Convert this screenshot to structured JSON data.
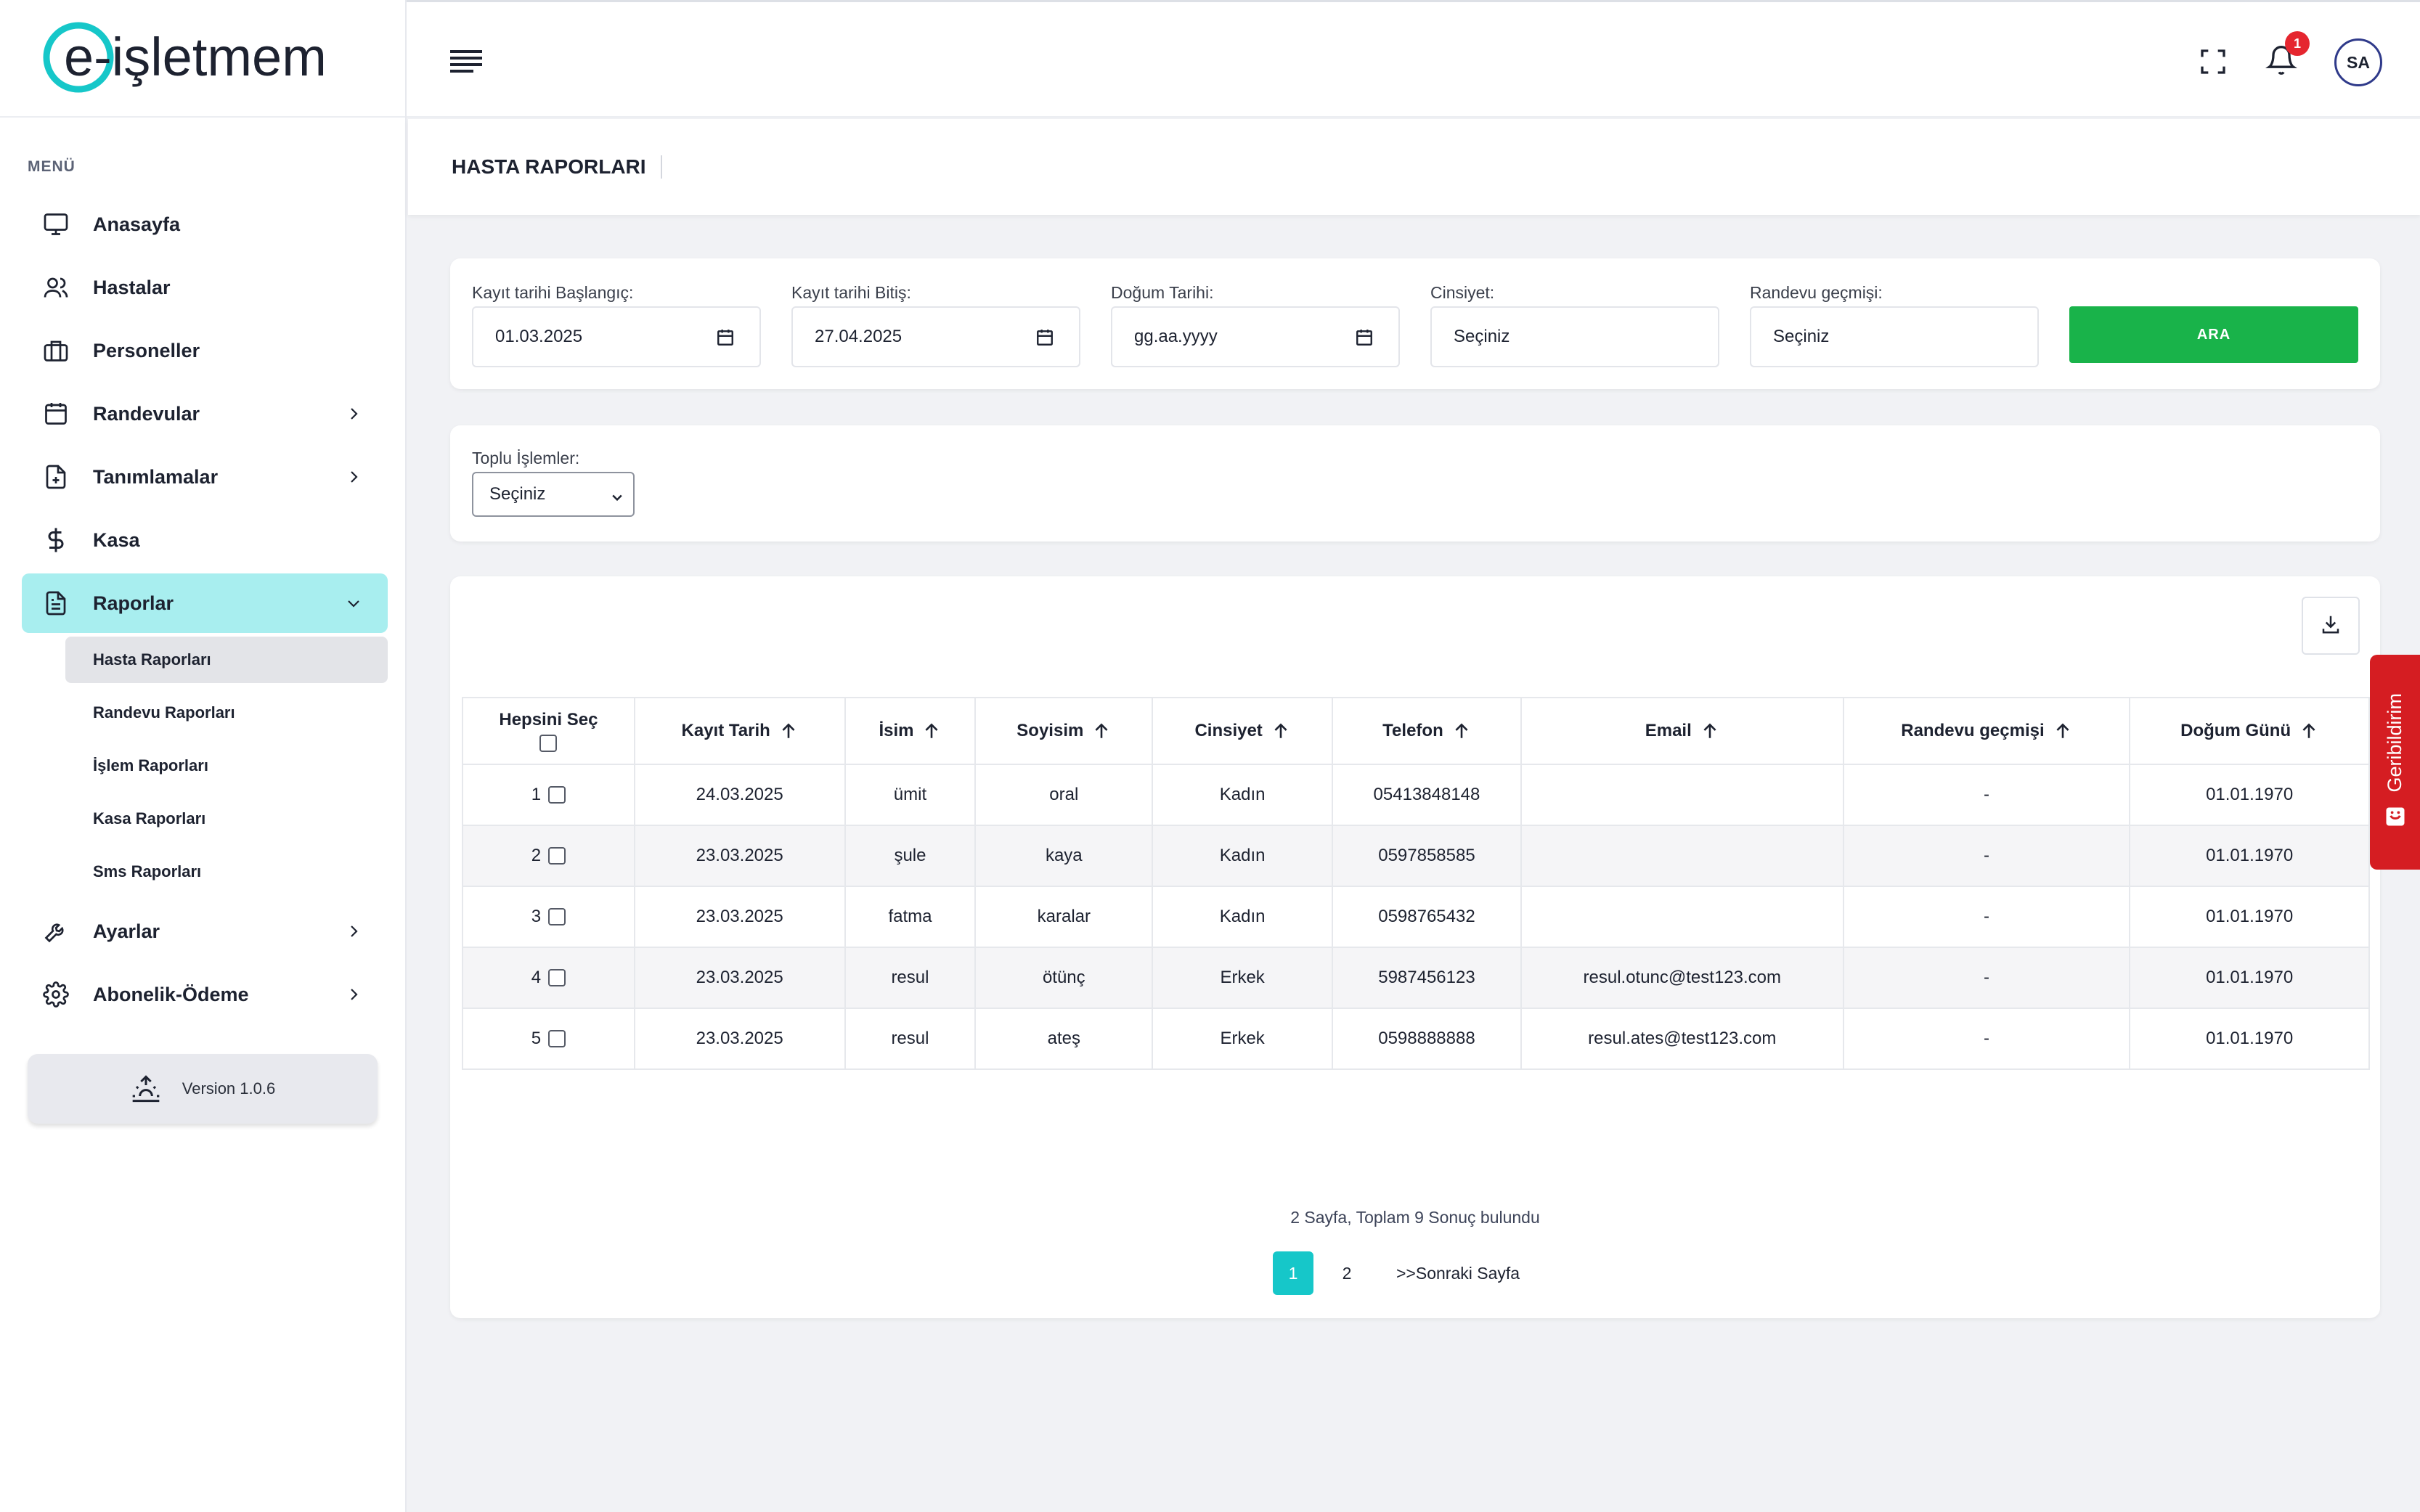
{
  "brand": {
    "logo_text": "e-işletmem",
    "accent": "#16c7c9",
    "primary_dark": "#1d2230"
  },
  "sidebar": {
    "menu_title": "MENÜ",
    "items": [
      {
        "label": "Anasayfa",
        "icon": "monitor-icon"
      },
      {
        "label": "Hastalar",
        "icon": "users-icon"
      },
      {
        "label": "Personeller",
        "icon": "briefcase-icon"
      },
      {
        "label": "Randevular",
        "icon": "calendar-icon"
      },
      {
        "label": "Tanımlamalar",
        "icon": "file-plus-icon"
      },
      {
        "label": "Kasa",
        "icon": "dollar-icon"
      },
      {
        "label": "Raporlar",
        "icon": "report-icon"
      },
      {
        "label": "Ayarlar",
        "icon": "wrench-icon"
      },
      {
        "label": "Abonelik-Ödeme",
        "icon": "gear-icon"
      }
    ],
    "sub_items": [
      {
        "label": "Hasta Raporları"
      },
      {
        "label": "Randevu Raporları"
      },
      {
        "label": "İşlem Raporları"
      },
      {
        "label": "Kasa Raporları"
      },
      {
        "label": "Sms Raporları"
      }
    ],
    "version": "Version 1.0.6"
  },
  "topbar": {
    "notification_count": "1",
    "avatar_initials": "SA"
  },
  "page": {
    "title": "HASTA RAPORLARI"
  },
  "filters": {
    "start_label": "Kayıt tarihi Başlangıç:",
    "start_value": "01.03.2025",
    "end_label": "Kayıt tarihi Bitiş:",
    "end_value": "27.04.2025",
    "birth_label": "Doğum Tarihi:",
    "birth_value": "gg.aa.yyyy",
    "gender_label": "Cinsiyet:",
    "gender_value": "Seçiniz",
    "history_label": "Randevu geçmişi:",
    "history_value": "Seçiniz",
    "search_button": "ARA"
  },
  "bulk": {
    "label": "Toplu İşlemler:",
    "value": "Seçiniz"
  },
  "table": {
    "columns": {
      "select_all": "Hepsini Seç",
      "date": "Kayıt Tarih",
      "name": "İsim",
      "surname": "Soyisim",
      "gender": "Cinsiyet",
      "phone": "Telefon",
      "email": "Email",
      "history": "Randevu geçmişi",
      "birthday": "Doğum Günü"
    },
    "rows": [
      {
        "no": "1",
        "date": "24.03.2025",
        "name": "ümit",
        "surname": "oral",
        "gender": "Kadın",
        "phone": "05413848148",
        "email": "",
        "history": "-",
        "birthday": "01.01.1970"
      },
      {
        "no": "2",
        "date": "23.03.2025",
        "name": "şule",
        "surname": "kaya",
        "gender": "Kadın",
        "phone": "0597858585",
        "email": "",
        "history": "-",
        "birthday": "01.01.1970"
      },
      {
        "no": "3",
        "date": "23.03.2025",
        "name": "fatma",
        "surname": "karalar",
        "gender": "Kadın",
        "phone": "0598765432",
        "email": "",
        "history": "-",
        "birthday": "01.01.1970"
      },
      {
        "no": "4",
        "date": "23.03.2025",
        "name": "resul",
        "surname": "ötünç",
        "gender": "Erkek",
        "phone": "5987456123",
        "email": "resul.otunc@test123.com",
        "history": "-",
        "birthday": "01.01.1970"
      },
      {
        "no": "5",
        "date": "23.03.2025",
        "name": "resul",
        "surname": "ateş",
        "gender": "Erkek",
        "phone": "0598888888",
        "email": "resul.ates@test123.com",
        "history": "-",
        "birthday": "01.01.1970"
      }
    ]
  },
  "pagination": {
    "summary": "2 Sayfa, Toplam 9 Sonuç bulundu",
    "pages": [
      "1",
      "2"
    ],
    "next": ">>Sonraki Sayfa"
  },
  "feedback": {
    "label": "Geribildirim"
  }
}
